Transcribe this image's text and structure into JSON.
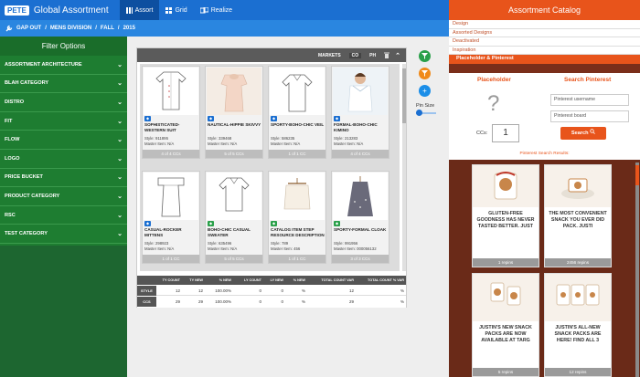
{
  "app": {
    "logo": "PETE",
    "title": "Global Assortment"
  },
  "nav": {
    "tabs": [
      {
        "label": "Assort"
      },
      {
        "label": "Grid"
      },
      {
        "label": "Realize"
      }
    ]
  },
  "breadcrumb": {
    "items": [
      "GAP OUT",
      "MENS DIVISION",
      "FALL",
      "2015"
    ],
    "sep": "/"
  },
  "sidebar": {
    "title": "Filter Options",
    "items": [
      {
        "label": "ASSORTMENT ARCHITECTURE"
      },
      {
        "label": "BLAH CATEGORY"
      },
      {
        "label": "DISTRO"
      },
      {
        "label": "FIT"
      },
      {
        "label": "FLOW"
      },
      {
        "label": "LOGO"
      },
      {
        "label": "PRICE BUCKET"
      },
      {
        "label": "PRODUCT CATEGORY"
      },
      {
        "label": "RSC"
      },
      {
        "label": "TEST CATEGORY"
      }
    ]
  },
  "toolbar": {
    "markets": "MARKETS",
    "co": "CO",
    "ph": "PH"
  },
  "cards": [
    {
      "title": "SOPHISTICATED-WESTERN SUIT",
      "style": "Style: 911895",
      "master": "Master Item: N/A",
      "ccs": "4 of 4 CCs",
      "badge": "blue"
    },
    {
      "title": "NAUTICAL-HIPPIE SKIVVY",
      "style": "Style: 339468",
      "master": "Master Item: N/A",
      "ccs": "5 of 5 CCs",
      "badge": "blue"
    },
    {
      "title": "SPORTY-BOHO-CHIC VEIL",
      "style": "Style: 586235",
      "master": "Master Item: N/A",
      "ccs": "1 of 1 CC",
      "badge": "blue"
    },
    {
      "title": "FORMAL-BOHO-CHIC KIMINO",
      "style": "Style: 213283",
      "master": "Master Item: N/A",
      "ccs": "4 of 4 CCs",
      "badge": "blue"
    },
    {
      "title": "CASUAL-ROCKER MITTENS",
      "style": "Style: 298923",
      "master": "Master Item: N/A",
      "ccs": "1 of 1 CC",
      "badge": "blue"
    },
    {
      "title": "BOHO-CHIC CASUAL SWEATER",
      "style": "Style: 635496",
      "master": "Master Item: N/A",
      "ccs": "5 of 5 CCs",
      "badge": "green"
    },
    {
      "title": "CATALOG ITEM STEP RESOURCE DESCRIPTION",
      "style": "Style: 789",
      "master": "Master Item: 456",
      "ccs": "1 of 1 CC",
      "badge": "green"
    },
    {
      "title": "SPORTY-FORMAL CLOAK",
      "style": "Style: 991956",
      "master": "Master Item: 000056132",
      "ccs": "3 of 3 CCs",
      "badge": "green"
    }
  ],
  "stats": {
    "headers": [
      "TY COUNT",
      "TY NEW",
      "% NEW",
      "LY COUNT",
      "LY NEW",
      "% NEW",
      "TOTAL COUNT VAR",
      "TOTAL COUNT % VAR"
    ],
    "rows": [
      {
        "label": "STYLE",
        "values": [
          "12",
          "12",
          "100.00%",
          "0",
          "0",
          "%",
          "12",
          "%"
        ]
      },
      {
        "label": "CCS",
        "values": [
          "29",
          "29",
          "100.00%",
          "0",
          "0",
          "%",
          "29",
          "%"
        ]
      }
    ]
  },
  "pin": {
    "label": "Pin Size"
  },
  "catalog": {
    "title": "Assortment Catalog",
    "links": [
      "Design",
      "Assorted Designs",
      "Deactivated",
      "Inspiration"
    ],
    "selected": "Placeholder & Pinterest",
    "placeholder": {
      "title": "Placeholder",
      "symbol": "?",
      "ccs_label": "CCs:",
      "ccs_value": "1"
    },
    "pinterest": {
      "title": "Search Pinterest",
      "username_placeholder": "Pinterest username",
      "board_placeholder": "Pinterest board",
      "search_label": "Search",
      "results_label": "Pinterest Search Results:"
    },
    "pins": [
      {
        "text": "GLUTEN-FREE GOODNESS HAS NEVER TASTED BETTER. JUST",
        "repins": "1 repins"
      },
      {
        "text": "THE MOST CONVENIENT SNACK YOU EVER DID PACK. JUSTI",
        "repins": "2456 repins"
      },
      {
        "text": "JUSTIN'S NEW SNACK PACKS ARE NOW AVAILABLE AT TARG",
        "repins": "5 repins"
      },
      {
        "text": "JUSTIN'S ALL-NEW SNACK PACKS ARE HERE! FIND ALL 3",
        "repins": "12 repins"
      }
    ]
  },
  "colors": {
    "nav_blue": "#1b6fd1",
    "sidebar_green": "#1e7d31",
    "accent_orange": "#e8541b",
    "fab_green": "#2aa04a",
    "fab_orange": "#f08a1a",
    "fab_blue": "#1b8ee8"
  }
}
